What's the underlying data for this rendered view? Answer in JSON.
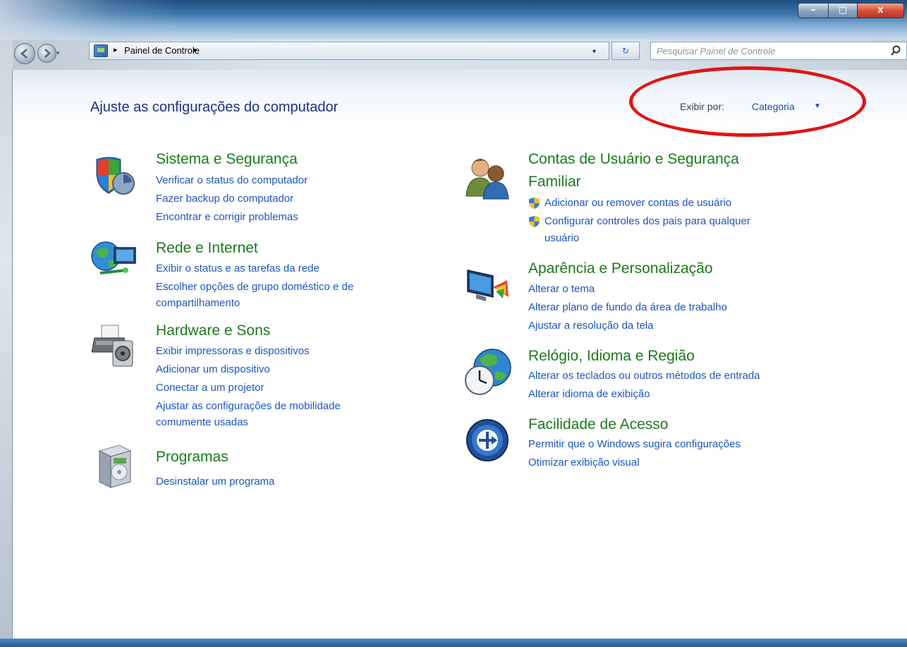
{
  "window": {
    "buttons": {
      "minimize": "–",
      "maximize": "□",
      "close": "x"
    }
  },
  "address": {
    "breadcrumb": "Painel de Controle",
    "separator": "▸",
    "dropdown": "▾",
    "refresh": "↻"
  },
  "search": {
    "placeholder": "Pesquisar Painel de Controle"
  },
  "header": {
    "title": "Ajuste as configurações do computador",
    "view_by_label": "Exibir por:",
    "view_by_value": "Categoria",
    "caret": "▼"
  },
  "categories_left": [
    {
      "title": "Sistema e Segurança",
      "icon": "shield-computer-icon",
      "links": [
        "Verificar o status do computador",
        "Fazer backup do computador",
        "Encontrar e corrigir problemas"
      ]
    },
    {
      "title": "Rede e Internet",
      "icon": "globe-network-icon",
      "links": [
        "Exibir o status e as tarefas da rede",
        "Escolher opções de grupo doméstico e de",
        "compartilhamento"
      ]
    },
    {
      "title": "Hardware e Sons",
      "icon": "printer-speaker-icon",
      "links": [
        "Exibir impressoras e dispositivos",
        "Adicionar um dispositivo",
        "Conectar a um projetor",
        "Ajustar as configurações de mobilidade",
        "comumente usadas"
      ]
    },
    {
      "title": "Programas",
      "icon": "programs-box-icon",
      "links": [
        "Desinstalar um programa"
      ]
    }
  ],
  "categories_right": [
    {
      "title": [
        "Contas de Usuário e Segurança",
        "Familiar"
      ],
      "icon": "users-icon",
      "links": [
        "Adicionar ou remover contas de usuário",
        "Configurar controles dos pais para qualquer",
        "usuário"
      ]
    },
    {
      "title": "Aparência e Personalização",
      "icon": "display-palette-icon",
      "links": [
        "Alterar o tema",
        "Alterar plano de fundo da área de trabalho",
        "Ajustar a resolução da tela"
      ]
    },
    {
      "title": "Relógio, Idioma e Região",
      "icon": "clock-globe-icon",
      "links": [
        "Alterar os teclados ou outros métodos de entrada",
        "Alterar idioma de exibição"
      ]
    },
    {
      "title": "Facilidade de Acesso",
      "icon": "accessibility-icon",
      "links": [
        "Permitir que o Windows sugira configurações",
        "Otimizar exibição visual"
      ]
    }
  ],
  "colors": {
    "category_title": "#1b7a1b",
    "link": "#1c55c4",
    "page_title": "#1e3287",
    "highlight_ring": "#e01515"
  }
}
